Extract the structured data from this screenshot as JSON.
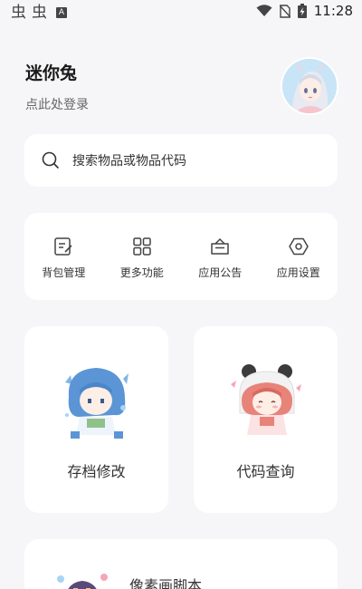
{
  "status_bar": {
    "left_glyphs": [
      "虫",
      "虫"
    ],
    "badge": "A",
    "time": "11:28"
  },
  "header": {
    "username": "迷你兔",
    "login_prompt": "点此处登录"
  },
  "search": {
    "placeholder": "搜索物品或物品代码"
  },
  "menu": {
    "items": [
      {
        "label": "背包管理",
        "icon": "backpack-edit-icon"
      },
      {
        "label": "更多功能",
        "icon": "grid-icon"
      },
      {
        "label": "应用公告",
        "icon": "announcement-icon"
      },
      {
        "label": "应用设置",
        "icon": "settings-hexagon-icon"
      }
    ]
  },
  "cards": [
    {
      "label": "存档修改",
      "icon": "save-edit-character-illustration"
    },
    {
      "label": "代码查询",
      "icon": "code-query-character-illustration"
    },
    {
      "label": "像素画脚本",
      "icon": "pixel-art-character-illustration"
    }
  ],
  "colors": {
    "background": "#f6f6f8",
    "card": "#ffffff",
    "text_primary": "#1a1a1a",
    "text_secondary": "#666666"
  }
}
